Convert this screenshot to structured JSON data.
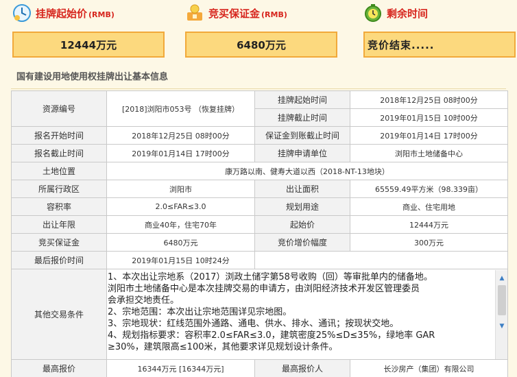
{
  "cards": {
    "start_price": {
      "label": "挂牌起始价",
      "unit": "(RMB)",
      "value": "12444万元"
    },
    "deposit": {
      "label": "竞买保证金",
      "unit": "(RMB)",
      "value": "6480万元"
    },
    "remaining": {
      "label": "剩余时间",
      "value": "竞价结束....."
    }
  },
  "section_title": "国有建设用地使用权挂牌出让基本信息",
  "table": {
    "resource_no_k": "资源编号",
    "resource_no_v": "[2018]浏阳市053号 （恢复挂牌）",
    "list_start_k": "挂牌起始时间",
    "list_start_v": "2018年12月25日 08时00分",
    "list_end_k": "挂牌截止时间",
    "list_end_v": "2019年01月15日 10时00分",
    "reg_start_k": "报名开始时间",
    "reg_start_v": "2018年12月25日 08时00分",
    "deposit_deadline_k": "保证金到账截止时间",
    "deposit_deadline_v": "2019年01月14日 17时00分",
    "reg_end_k": "报名截止时间",
    "reg_end_v": "2019年01月14日 17时00分",
    "applicant_k": "挂牌申请单位",
    "applicant_v": "浏阳市土地储备中心",
    "location_k": "土地位置",
    "location_v": "康万路以南、健寿大道以西（2018-NT-13地块）",
    "district_k": "所属行政区",
    "district_v": "浏阳市",
    "area_k": "出让面积",
    "area_v": "65559.49平方米（98.339亩）",
    "far_k": "容积率",
    "far_v": "2.0≤FAR≤3.0",
    "use_k": "规划用途",
    "use_v": "商业、住宅用地",
    "years_k": "出让年限",
    "years_v": "商业40年，住宅70年",
    "start_price_k": "起始价",
    "start_price_v": "12444万元",
    "deposit_k": "竞买保证金",
    "deposit_v": "6480万元",
    "increment_k": "竞价增价幅度",
    "increment_v": "300万元",
    "last_quote_k": "最后报价时间",
    "last_quote_v": "2019年01月15日 10时24分",
    "terms_k": "其他交易条件",
    "terms": [
      "1、本次出让宗地系（2017）浏政土储字第58号收购（回）等审批单内的储备地。",
      "浏阳市土地储备中心是本次挂牌交易的申请方，由浏阳经济技术开发区管理委员",
      "会承担交地责任。",
      "2、宗地范围：本次出让宗地范围详见宗地图。",
      "3、宗地现状：红线范围外通路、通电、供水、排水、通讯；按现状交地。",
      "4、规划指标要求：容积率2.0≤FAR≤3.0，建筑密度25%≤D≤35%，绿地率 GAR",
      "≥30%，建筑限高≤100米，其他要求详见规划设计条件。"
    ],
    "top_price_k": "最高报价",
    "top_price_v": "16344万元 [16344万元]",
    "top_bidder_k": "最高报价人",
    "top_bidder_v": "长沙房产（集团）有限公司"
  },
  "colors": {
    "accent": "#d7261e",
    "card_bg": "#fcd97e",
    "card_border": "#f1a93a",
    "page_bg": "#fdf8e6"
  },
  "icons": [
    "price-clock-icon",
    "deposit-icon",
    "timer-icon"
  ]
}
